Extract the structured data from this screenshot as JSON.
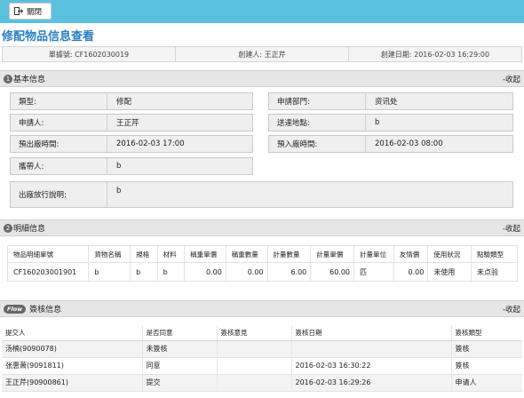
{
  "toolbar": {
    "close_label": "關閉"
  },
  "page_title": "修配物品信息查看",
  "meta": {
    "doc_no": "單據號: CF1602030019",
    "creator": "創建人: 王正芹",
    "created_date": "創建日期: 2016-02-03 16:29:00"
  },
  "sections": {
    "basic": {
      "num": "1",
      "title": "基本信息",
      "toggle": "-收起"
    },
    "detail": {
      "num": "2",
      "title": "明細信息",
      "toggle": "-收起"
    },
    "flow": {
      "badge": "Flow",
      "title": "簽核信息",
      "toggle": "-收起"
    }
  },
  "basic_fields": {
    "type": {
      "label": "類型:",
      "value": "修配"
    },
    "dept": {
      "label": "申請部門:",
      "value": "资讯处"
    },
    "applicant": {
      "label": "申請人:",
      "value": "王正芹"
    },
    "site": {
      "label": "送達地點:",
      "value": "b"
    },
    "exit_time": {
      "label": "預出廠時間:",
      "value": "2016-02-03 17:00"
    },
    "enter_time": {
      "label": "預入廠時間:",
      "value": "2016-02-03 08:00"
    },
    "carrier": {
      "label": "攜帶人:",
      "value": "b"
    },
    "release_note": {
      "label": "出廠放行說明:",
      "value": "b"
    }
  },
  "detail_table": {
    "headers": [
      "物品明細單號",
      "貨物名稱",
      "規格",
      "材料",
      "稱重單價",
      "稱重數量",
      "計量數量",
      "計量單價",
      "計量單位",
      "友情價",
      "使用狀況",
      "點驗類型"
    ],
    "rows": [
      [
        "CF160203001901",
        "b",
        "b",
        "b",
        "0.00",
        "0.00",
        "6.00",
        "60.00",
        "匹",
        "0.00",
        "未使用",
        "未点验"
      ]
    ]
  },
  "flow_table": {
    "headers": [
      "提交人",
      "是否同意",
      "簽核意見",
      "簽核日期",
      "簽核類型"
    ],
    "rows": [
      [
        "汤楠(9090078)",
        "未簽核",
        "",
        "",
        "簽核"
      ],
      [
        "张惠萧(9091811)",
        "同意",
        "",
        "2016-02-03 16:30:22",
        "簽核"
      ],
      [
        "王正芹(90900861)",
        "提交",
        "",
        "2016-02-03 16:29:26",
        "申请人"
      ]
    ]
  },
  "colors": {
    "topbar": "#5bc0de",
    "title": "#2b7fc3",
    "section_bg": "#e6e6e6"
  }
}
